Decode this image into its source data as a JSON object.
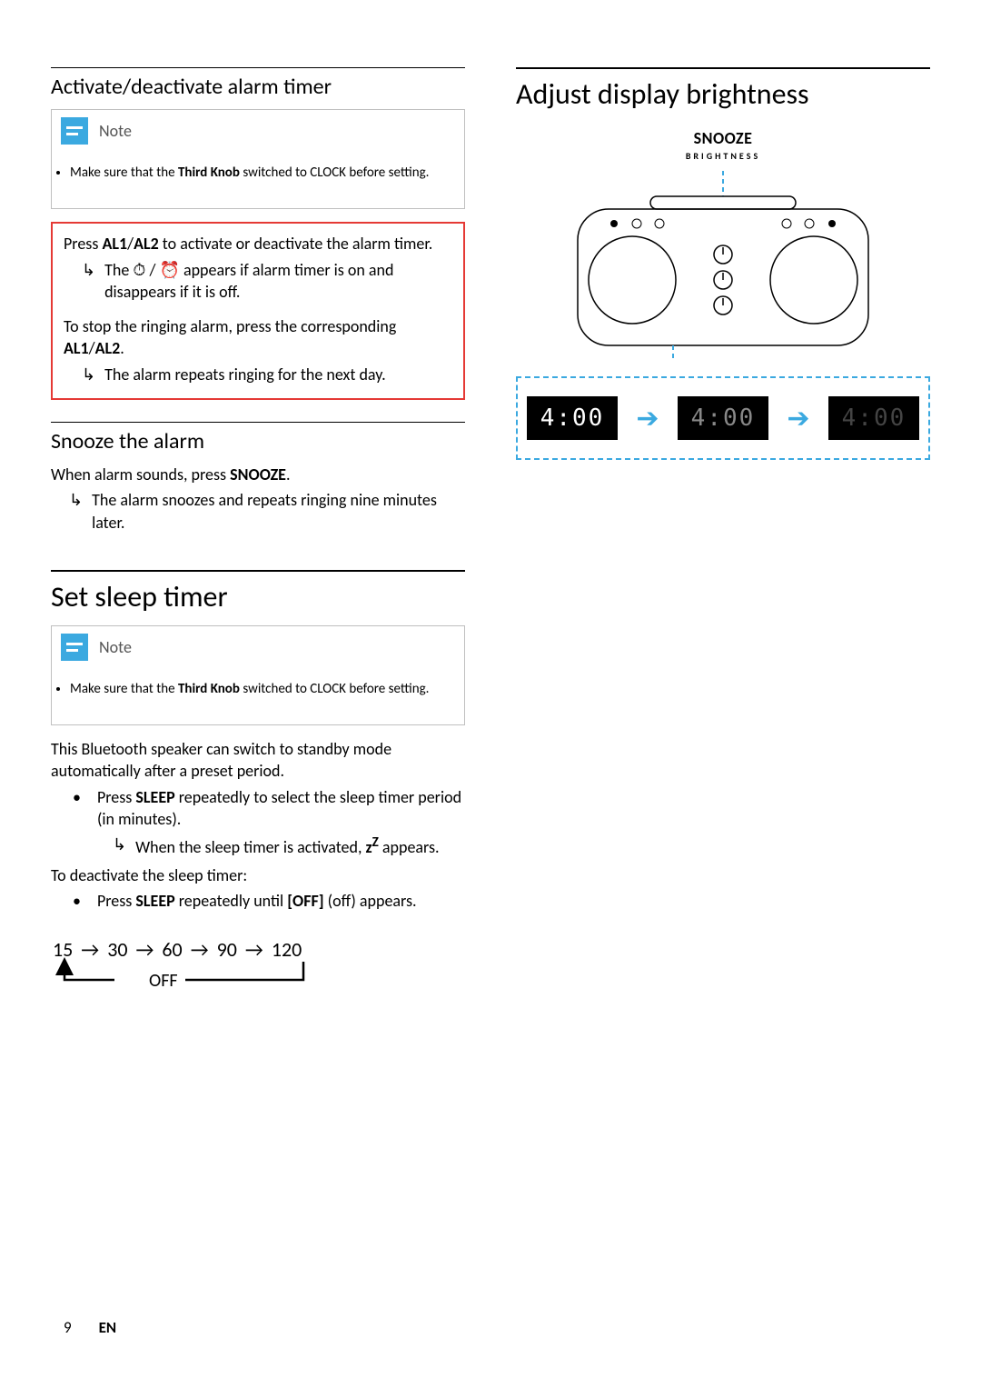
{
  "left": {
    "sub1": {
      "title": "Activate/deactivate alarm timer",
      "note_label": "Note",
      "note_text_pre": "Make sure that the ",
      "note_text_bold": "Third Knob",
      "note_text_mid": " switched to ",
      "note_text_clock": "CLOCK",
      "note_text_post": " before setting.",
      "press_pre": "Press ",
      "press_b1": "AL1",
      "press_slash": "/",
      "press_b2": "AL2",
      "press_post": " to activate or deactivate the alarm timer.",
      "result1_pre": "The ",
      "result1_icons": "⏱ / ⏰",
      "result1_post": " appears if alarm timer is on and disappears if it is off.",
      "stop_pre": "To stop the ringing alarm, press the corresponding ",
      "stop_b1": "AL1",
      "stop_slash": "/",
      "stop_b2": "AL2",
      "stop_post": ".",
      "result2": "The alarm repeats ringing for the next day."
    },
    "sub2": {
      "title": "Snooze the alarm",
      "line_pre": "When alarm sounds, press ",
      "line_bold": "SNOOZE",
      "line_post": ".",
      "result": "The alarm snoozes and repeats ringing nine minutes later."
    },
    "sleep": {
      "title": "Set sleep timer",
      "note_label": "Note",
      "note_text_pre": "Make sure that the ",
      "note_text_bold": "Third Knob",
      "note_text_mid": " switched to ",
      "note_text_clock": "CLOCK",
      "note_text_post": " before setting.",
      "intro": "This Bluetooth speaker can switch to standby mode automatically after a preset period.",
      "b1_pre": "Press ",
      "b1_bold": "SLEEP",
      "b1_post": " repeatedly to select the sleep timer period (in minutes).",
      "b1_r_pre": "When the sleep timer is activated, ",
      "b1_r_icon": "z",
      "b1_r_icon2": "Z",
      "b1_r_post": " appears.",
      "deact_title": "To deactivate the sleep timer:",
      "b2_pre": "Press ",
      "b2_bold": "SLEEP",
      "b2_mid": " repeatedly until ",
      "b2_off": "[OFF]",
      "b2_post": " (off) appears.",
      "cycle": {
        "v1": "15",
        "v2": "30",
        "v3": "60",
        "v4": "90",
        "v5": "120",
        "off": "OFF"
      }
    }
  },
  "right": {
    "title": "Adjust display brightness",
    "snooze_label": "SNOOZE",
    "brightness_label": "BRIGHTNESS",
    "lcd_value": "4:00"
  },
  "footer": {
    "page": "9",
    "lang": "EN"
  }
}
